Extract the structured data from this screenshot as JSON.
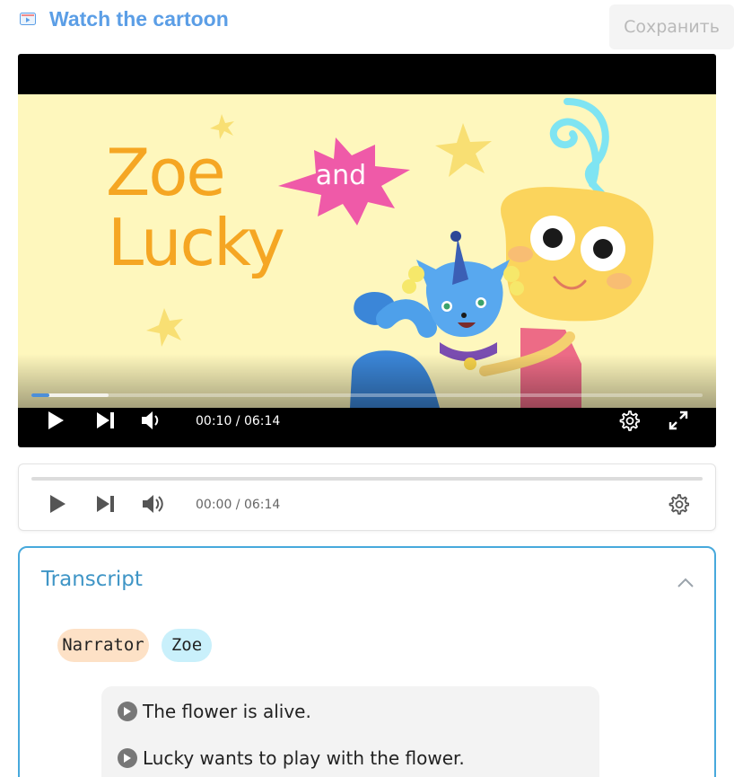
{
  "header": {
    "title": "Watch the cartoon",
    "save_label": "Сохранить",
    "icon": "video-lesson-icon"
  },
  "video": {
    "logo_line1": "Zoe",
    "logo_line2": "Lucky",
    "logo_and": "and",
    "time": "00:10 / 06:14",
    "progress": 0.027,
    "controls": [
      "play-icon",
      "skip-next-icon",
      "volume-icon",
      "settings-icon",
      "fullscreen-icon"
    ]
  },
  "audio": {
    "time": "00:00 / 06:14",
    "progress": 0,
    "controls": [
      "play-icon",
      "skip-next-icon",
      "volume-icon",
      "settings-icon"
    ]
  },
  "transcript": {
    "title": "Transcript",
    "speakers": [
      {
        "label": "Narrator",
        "color": "#fde1c6"
      },
      {
        "label": "Zoe",
        "color": "#c9f0fb"
      }
    ],
    "lines": [
      {
        "text": "The flower is alive."
      },
      {
        "text": "Lucky wants to play with the flower."
      }
    ]
  },
  "colors": {
    "accent": "#5b9ee6",
    "transcript_border": "#47a9dc",
    "progress": "#4d8fd8"
  }
}
